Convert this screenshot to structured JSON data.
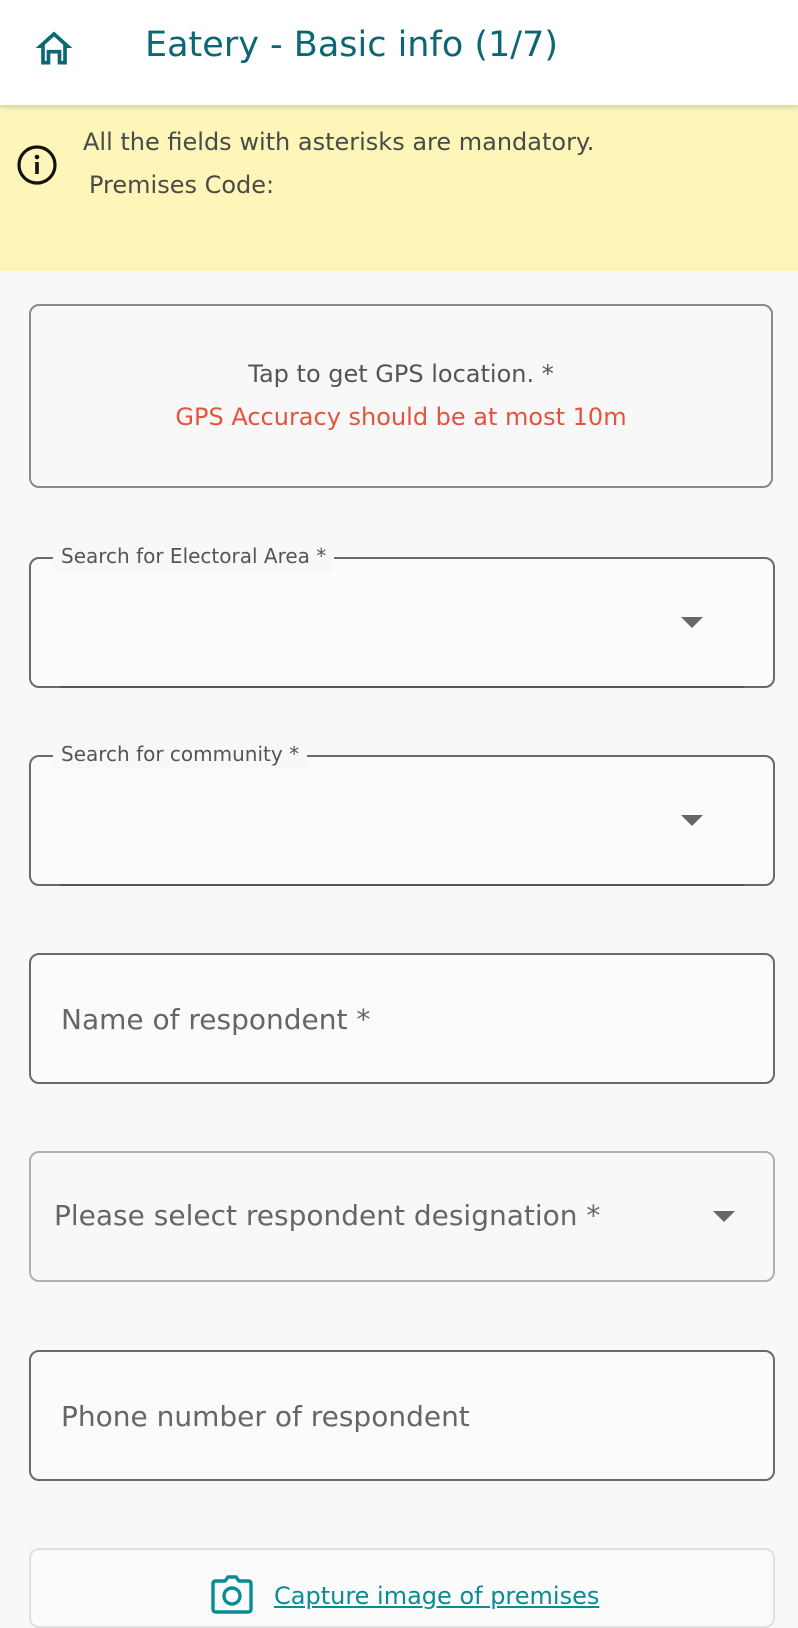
{
  "appbar": {
    "title": "Eatery - Basic info (1/7)",
    "home_icon": "home-icon",
    "accent_color": "#0b6773"
  },
  "notice": {
    "icon": "info-icon",
    "line1": "All the fields with asterisks are mandatory.",
    "line2": "Premises Code:",
    "background_color": "#fdf6b8"
  },
  "gps": {
    "title": "Tap to get GPS location. *",
    "warning": "GPS Accuracy should be at most 10m",
    "warning_color": "#e5533d"
  },
  "form": {
    "electoral_area": {
      "label": "Search for Electoral Area *",
      "value": ""
    },
    "community": {
      "label": "Search for community *",
      "value": ""
    },
    "respondent_name": {
      "placeholder": "Name of respondent *",
      "value": ""
    },
    "designation": {
      "placeholder": "Please select respondent designation *"
    },
    "phone": {
      "placeholder": "Phone number of respondent",
      "value": ""
    }
  },
  "capture": {
    "label": "Capture image of premises",
    "icon": "camera-icon",
    "color": "#0a8c93"
  }
}
